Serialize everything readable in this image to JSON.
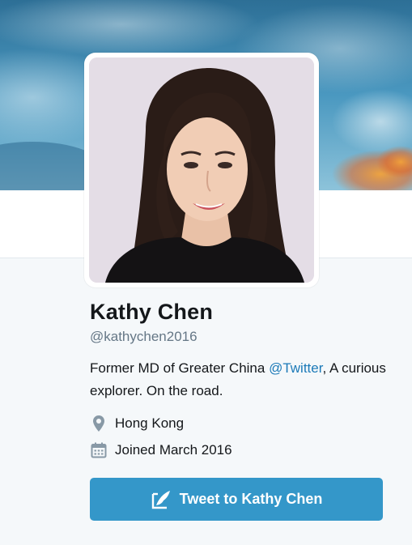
{
  "profile": {
    "name": "Kathy Chen",
    "handle": "@kathychen2016",
    "bio_prefix": "Former MD of Greater China ",
    "bio_mention": "@Twitter",
    "bio_suffix": ", A curious explorer. On the road.",
    "location": "Hong Kong",
    "joined": "Joined March 2016"
  },
  "actions": {
    "tweet_to_label": "Tweet to Kathy Chen"
  },
  "icons": {
    "location": "map-pin-icon",
    "joined": "calendar-icon",
    "tweet": "compose-quill-icon"
  },
  "colors": {
    "button_bg": "#3497c9",
    "mention": "#1c7ab8",
    "handle": "#657786",
    "page_bg": "#f5f8fa"
  }
}
